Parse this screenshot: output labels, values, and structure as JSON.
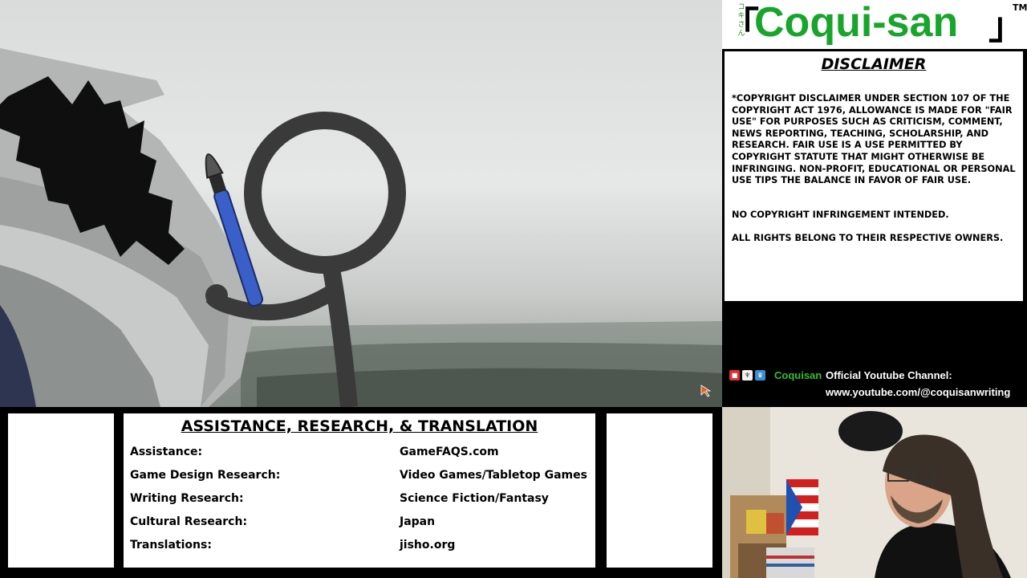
{
  "logo": {
    "name": "Coqui-san",
    "kana": "コキさん",
    "trademark": "TM"
  },
  "disclaimer": {
    "title": "DISCLAIMER",
    "paragraphs": [
      "*COPYRIGHT DISCLAIMER UNDER SECTION 107 OF THE COPYRIGHT ACT 1976, ALLOWANCE IS MADE FOR \"FAIR USE\" FOR PURPOSES SUCH AS CRITICISM, COMMENT, NEWS REPORTING, TEACHING, SCHOLARSHIP, AND RESEARCH. FAIR USE IS A USE PERMITTED BY COPYRIGHT STATUTE THAT MIGHT OTHERWISE BE INFRINGING. NON-PROFIT, EDUCATIONAL OR PERSONAL USE TIPS THE BALANCE IN FAVOR OF FAIR USE.",
      "NO COPYRIGHT INFRINGEMENT INTENDED.",
      "ALL RIGHTS BELONG TO THEIR RESPECTIVE OWNERS."
    ]
  },
  "channel": {
    "name": "Coquisan",
    "label": "Official Youtube Channel:",
    "url": "www.youtube.com/@coquisanwriting",
    "icons": [
      "video-camera-icon",
      "trophy-icon",
      "crown-icon"
    ]
  },
  "credits": {
    "title": "ASSISTANCE, RESEARCH, & TRANSLATION",
    "rows": [
      {
        "label": "Assistance:",
        "value": "GameFAQS.com"
      },
      {
        "label": "Game Design Research:",
        "value": "Video Games/Tabletop Games"
      },
      {
        "label": "Writing Research:",
        "value": "Science Fiction/Fantasy"
      },
      {
        "label": "Cultural Research:",
        "value": "Japan"
      },
      {
        "label": "Translations:",
        "value": "jisho.org"
      }
    ]
  },
  "colors": {
    "logo_green": "#18a52b",
    "channel_green": "#2ec02e",
    "brush_blue": "#3a5fc8"
  }
}
